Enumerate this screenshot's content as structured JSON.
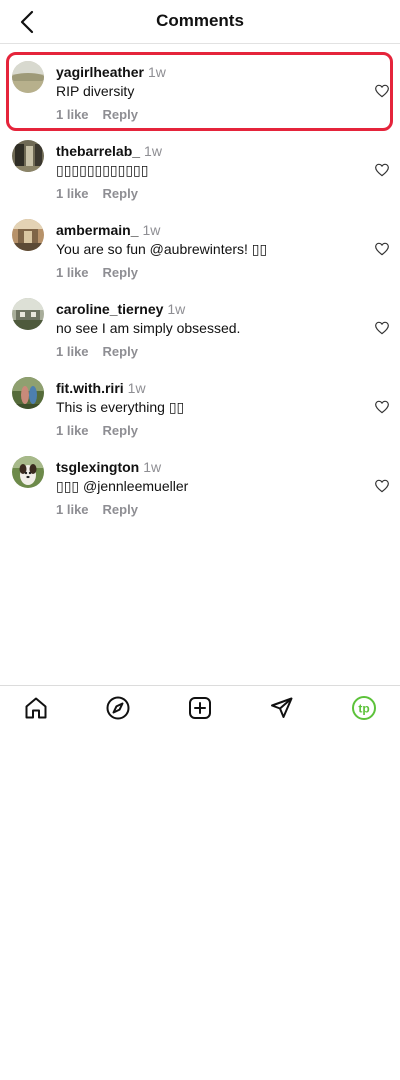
{
  "header": {
    "title": "Comments",
    "back_icon": "chevron-left-icon"
  },
  "comments": [
    {
      "username": "yagirlheather",
      "time": "1w",
      "text": "RIP diversity",
      "likes": "1 like",
      "reply": "Reply",
      "highlighted": true
    },
    {
      "username": "thebarrelab_",
      "time": "1w",
      "text": "▯▯▯▯▯▯▯▯▯▯▯▯",
      "likes": "1 like",
      "reply": "Reply"
    },
    {
      "username": "ambermain_",
      "time": "1w",
      "text": "You are so fun @aubrewinters! ▯▯",
      "likes": "1 like",
      "reply": "Reply"
    },
    {
      "username": "caroline_tierney",
      "time": "1w",
      "text": "no see I am simply obsessed.",
      "likes": "1 like",
      "reply": "Reply"
    },
    {
      "username": "fit.with.riri",
      "time": "1w",
      "text": "This is everything ▯▯",
      "likes": "1 like",
      "reply": "Reply"
    },
    {
      "username": "tsglexington",
      "time": "1w",
      "text": "▯▯▯ @jennleemueller",
      "likes": "1 like",
      "reply": "Reply"
    }
  ],
  "nav": {
    "items": [
      "home-icon",
      "compass-icon",
      "add-post-icon",
      "send-icon",
      "profile-icon"
    ],
    "profile_initials": "tp",
    "profile_color": "#5cc23a"
  },
  "colors": {
    "highlight": "#e5243b",
    "muted": "#8e8e93"
  }
}
